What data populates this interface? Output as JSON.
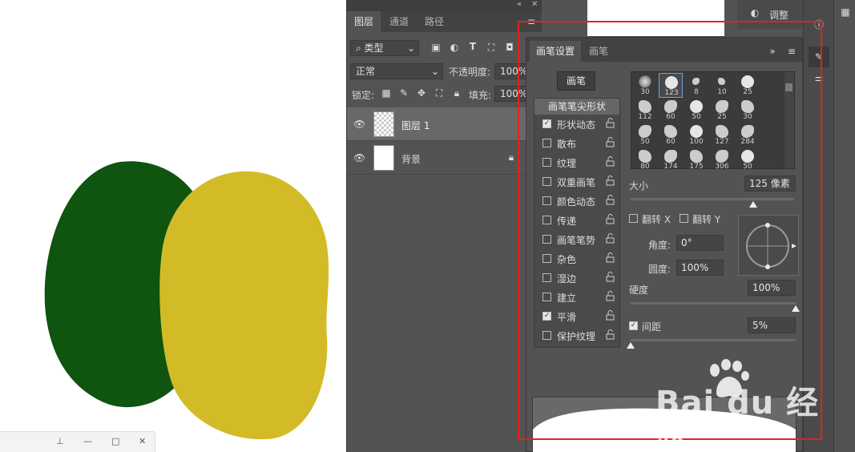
{
  "layers_panel": {
    "tabs": [
      "图层",
      "通道",
      "路径"
    ],
    "filter_kind": "类型",
    "blend_mode": "正常",
    "opacity_label": "不透明度:",
    "opacity_value": "100%",
    "lock_label": "锁定:",
    "fill_label": "填充:",
    "fill_value": "100%",
    "layers": [
      {
        "name": "图层 1"
      },
      {
        "name": "背景"
      }
    ]
  },
  "adjust_panel": {
    "label": "调整"
  },
  "brush_settings": {
    "tabs": [
      "画笔设置",
      "画笔"
    ],
    "brush_button": "画笔",
    "options_header": "画笔笔尖形状",
    "options": [
      {
        "label": "形状动态",
        "checked": true
      },
      {
        "label": "散布",
        "checked": false
      },
      {
        "label": "纹理",
        "checked": false
      },
      {
        "label": "双重画笔",
        "checked": false
      },
      {
        "label": "颜色动态",
        "checked": false
      },
      {
        "label": "传递",
        "checked": false
      },
      {
        "label": "画笔笔势",
        "checked": false
      },
      {
        "label": "杂色",
        "checked": false
      },
      {
        "label": "湿边",
        "checked": false
      },
      {
        "label": "建立",
        "checked": false
      },
      {
        "label": "平滑",
        "checked": true
      },
      {
        "label": "保护纹理",
        "checked": false
      }
    ],
    "tips": [
      "30",
      "123",
      "8",
      "10",
      "25",
      "112",
      "60",
      "50",
      "25",
      "30",
      "50",
      "60",
      "100",
      "127",
      "284",
      "80",
      "174",
      "175",
      "306",
      "50"
    ],
    "size_label": "大小",
    "size_value": "125 像素",
    "flip_x": "翻转 X",
    "flip_y": "翻转 Y",
    "angle_label": "角度:",
    "angle_value": "0°",
    "roundness_label": "圆度:",
    "roundness_value": "100%",
    "hardness_label": "硬度",
    "hardness_value": "100%",
    "spacing_label": "间距",
    "spacing_value": "5%",
    "size_slider_level": 0.75,
    "hardness_slider_level": 1.0,
    "spacing_slider_level": 0.0
  },
  "watermark": {
    "brand": "Bai du 经验",
    "url": "jingyan.baidu.com"
  },
  "colors": {
    "dark_green": "#0f540f",
    "mustard": "#d3bb27",
    "highlight": "#e0241c"
  }
}
